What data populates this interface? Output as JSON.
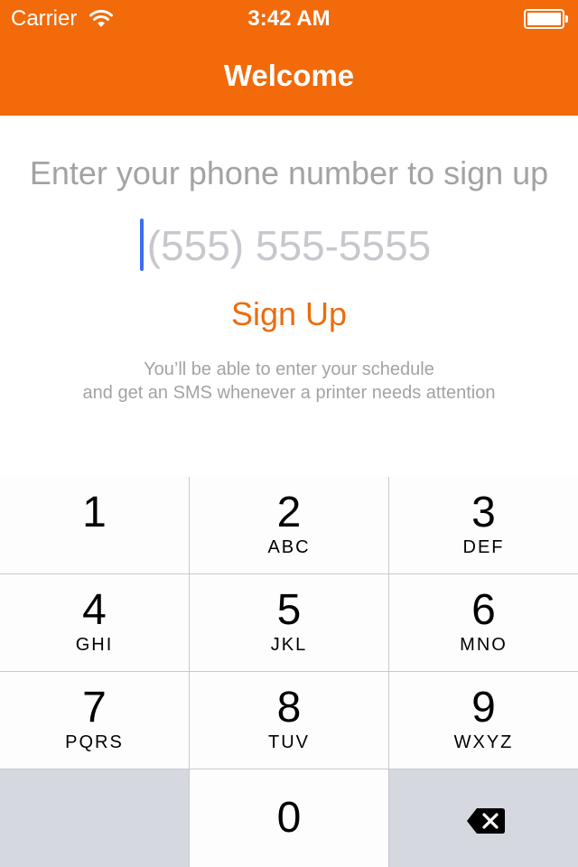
{
  "status_bar": {
    "carrier": "Carrier",
    "time": "3:42 AM",
    "wifi_icon": "wifi-icon",
    "battery_icon": "battery-full-icon"
  },
  "nav": {
    "title": "Welcome"
  },
  "content": {
    "prompt": "Enter your phone number to sign up",
    "phone_placeholder": "(555) 555-5555",
    "phone_value": "",
    "signup_label": "Sign Up",
    "info_line1": "You’ll be able to enter your schedule",
    "info_line2": "and get an SMS whenever a printer needs attention"
  },
  "keypad": {
    "keys": [
      {
        "digit": "1",
        "letters": ""
      },
      {
        "digit": "2",
        "letters": "ABC"
      },
      {
        "digit": "3",
        "letters": "DEF"
      },
      {
        "digit": "4",
        "letters": "GHI"
      },
      {
        "digit": "5",
        "letters": "JKL"
      },
      {
        "digit": "6",
        "letters": "MNO"
      },
      {
        "digit": "7",
        "letters": "PQRS"
      },
      {
        "digit": "8",
        "letters": "TUV"
      },
      {
        "digit": "9",
        "letters": "WXYZ"
      },
      {
        "digit": "0",
        "letters": ""
      }
    ],
    "backspace_icon": "backspace-icon"
  },
  "colors": {
    "accent": "#f26a0a",
    "link": "#ec6c0e",
    "cursor": "#3c6cf0",
    "muted_text": "#a3a3a3"
  }
}
